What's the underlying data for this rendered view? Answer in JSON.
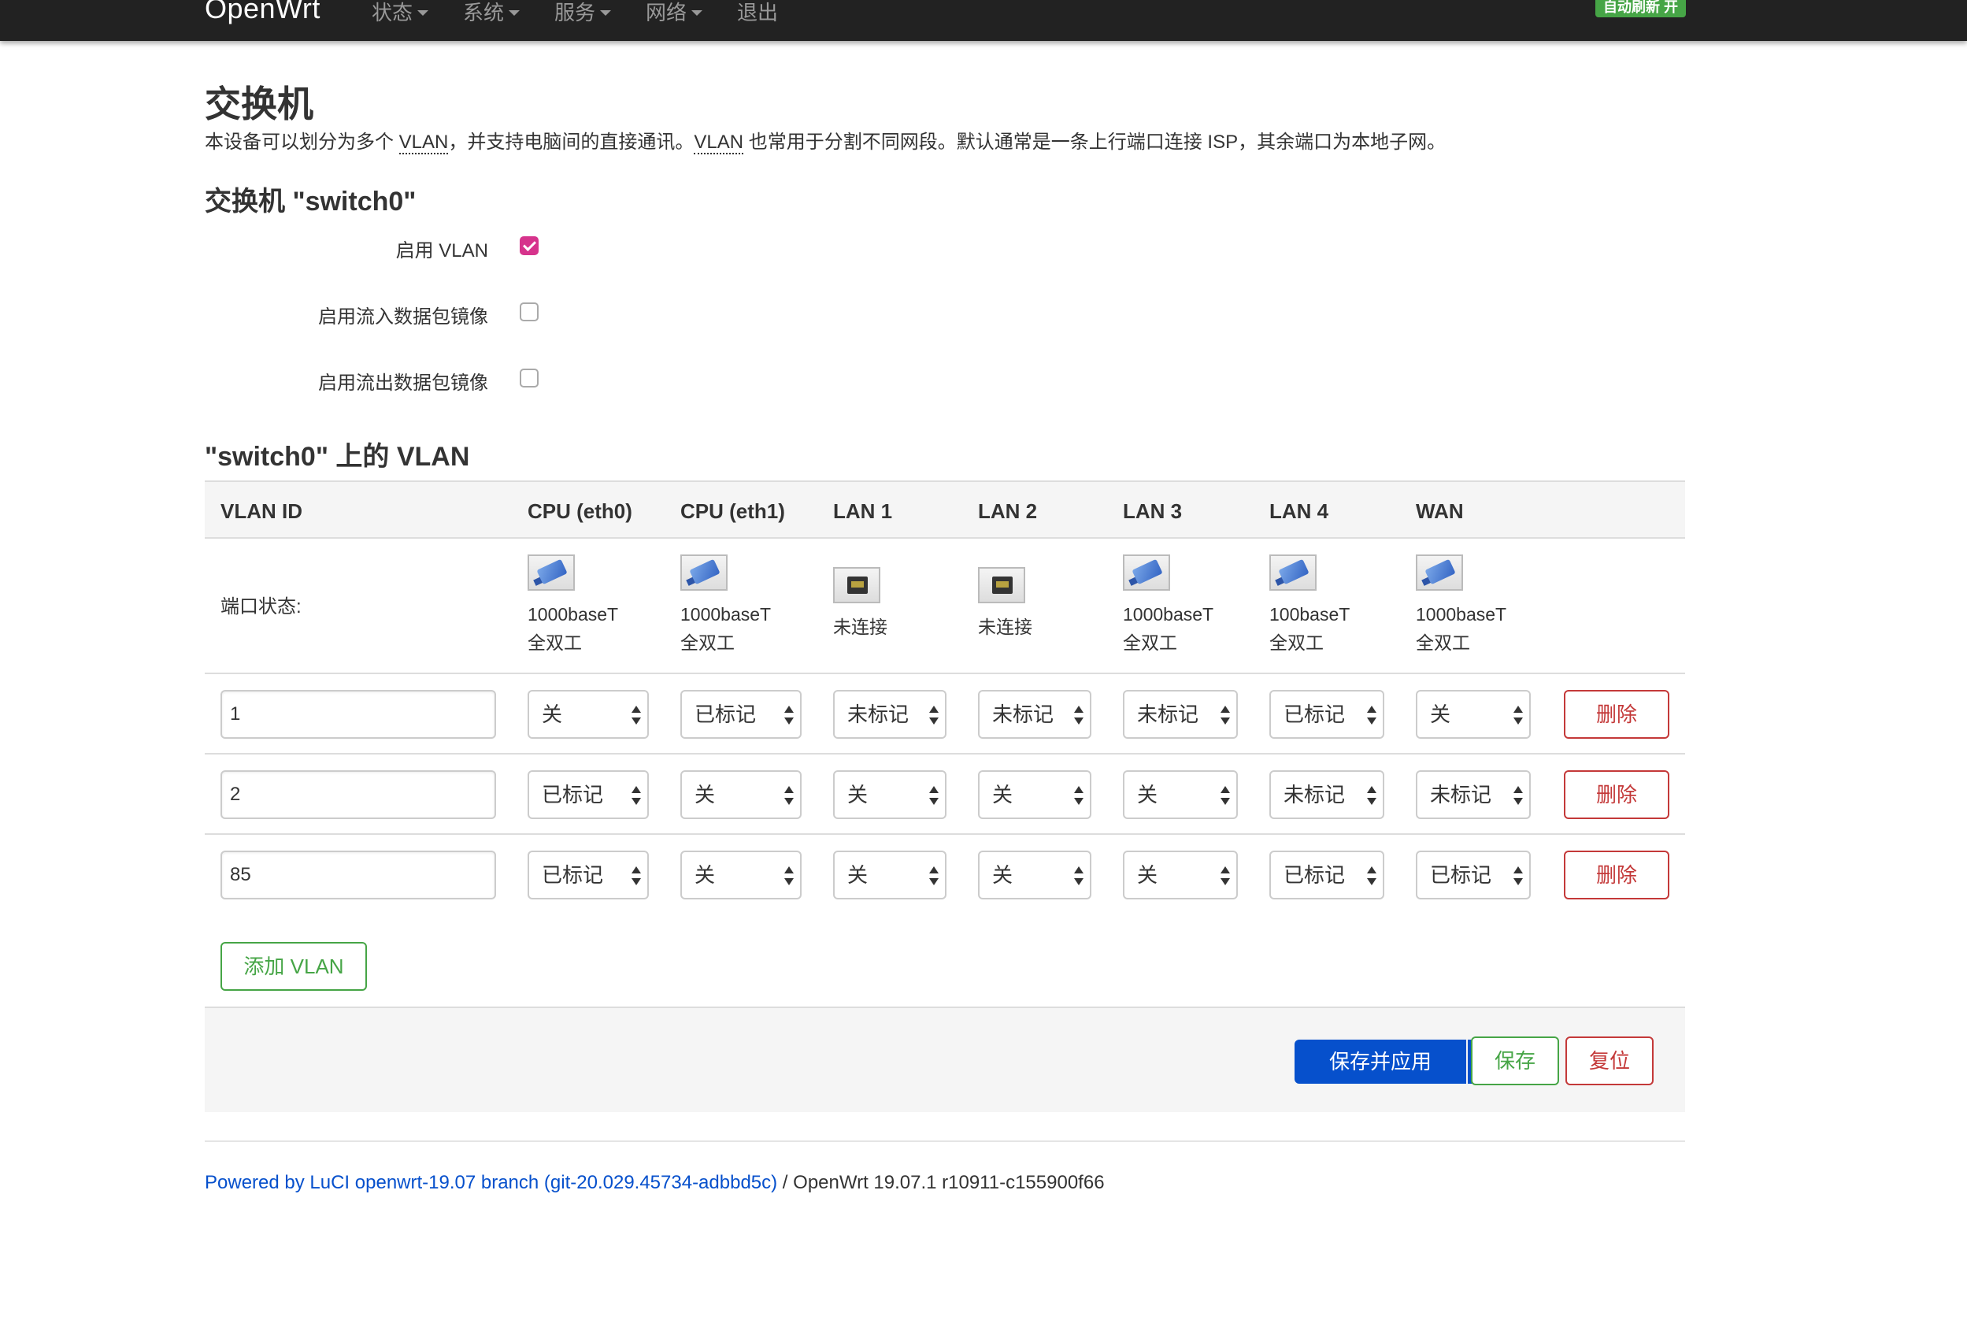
{
  "nav": {
    "brand": "OpenWrt",
    "items": [
      {
        "label": "状态",
        "dropdown": true
      },
      {
        "label": "系统",
        "dropdown": true
      },
      {
        "label": "服务",
        "dropdown": true
      },
      {
        "label": "网络",
        "dropdown": true
      },
      {
        "label": "退出",
        "dropdown": false
      }
    ],
    "refresh_badge": "自动刷新 开"
  },
  "page": {
    "title": "交换机",
    "description_parts": [
      "本设备可以划分为多个 ",
      "VLAN",
      "，并支持电脑间的直接通讯。",
      "VLAN",
      " 也常用于分割不同网段。默认通常是一条上行端口连接 ISP，其余端口为本地子网。"
    ]
  },
  "switch": {
    "title": "交换机 \"switch0\"",
    "options": [
      {
        "label": "启用 VLAN",
        "checked": true
      },
      {
        "label": "启用流入数据包镜像",
        "checked": false
      },
      {
        "label": "启用流出数据包镜像",
        "checked": false
      }
    ]
  },
  "vlan_section": {
    "title": "\"switch0\" 上的 VLAN",
    "headers": [
      "VLAN ID",
      "CPU (eth0)",
      "CPU (eth1)",
      "LAN 1",
      "LAN 2",
      "LAN 3",
      "LAN 4",
      "WAN"
    ],
    "port_status_label": "端口状态:",
    "ports": [
      {
        "state": "connected",
        "speed": "1000baseT",
        "duplex": "全双工"
      },
      {
        "state": "connected",
        "speed": "1000baseT",
        "duplex": "全双工"
      },
      {
        "state": "disconnected",
        "speed": "未连接",
        "duplex": ""
      },
      {
        "state": "disconnected",
        "speed": "未连接",
        "duplex": ""
      },
      {
        "state": "connected",
        "speed": "1000baseT",
        "duplex": "全双工"
      },
      {
        "state": "connected",
        "speed": "100baseT",
        "duplex": "全双工"
      },
      {
        "state": "connected",
        "speed": "1000baseT",
        "duplex": "全双工"
      }
    ],
    "rows": [
      {
        "vlan_id": "1",
        "values": [
          "关",
          "已标记",
          "未标记",
          "未标记",
          "未标记",
          "已标记",
          "关"
        ]
      },
      {
        "vlan_id": "2",
        "values": [
          "已标记",
          "关",
          "关",
          "关",
          "关",
          "未标记",
          "未标记"
        ]
      },
      {
        "vlan_id": "85",
        "values": [
          "已标记",
          "关",
          "关",
          "关",
          "关",
          "已标记",
          "已标记"
        ]
      }
    ],
    "delete_label": "删除",
    "add_label": "添加 VLAN"
  },
  "actions": {
    "save_apply": "保存并应用",
    "save": "保存",
    "reset": "复位"
  },
  "footer": {
    "powered_link": "Powered by LuCI openwrt-19.07 branch (git-20.029.45734-adbbd5c)",
    "version": " / OpenWrt 19.07.1 r10911-c155900f66"
  }
}
